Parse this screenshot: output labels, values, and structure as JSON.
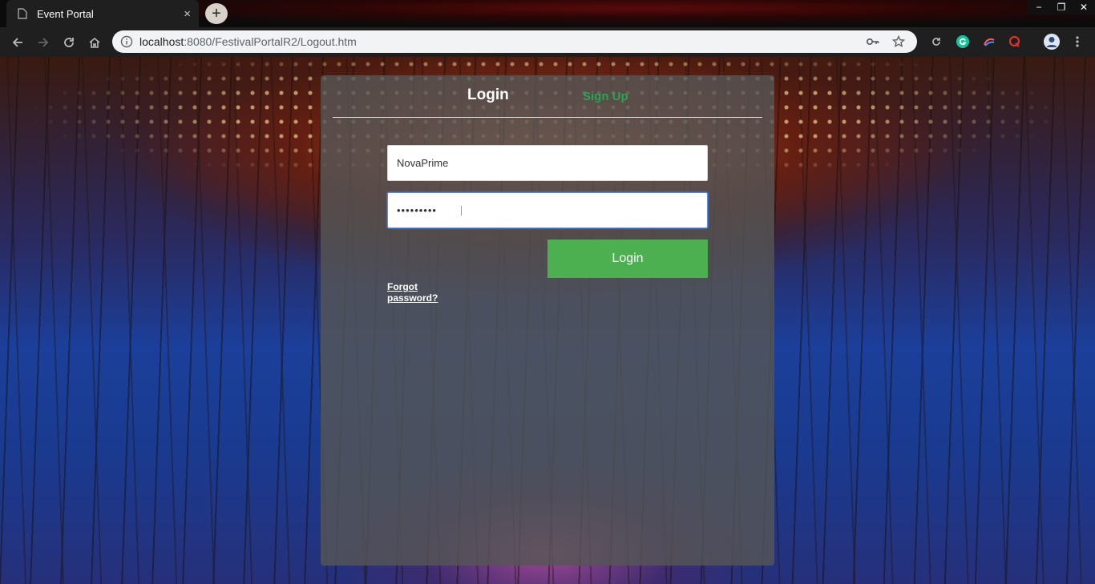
{
  "browser": {
    "tab_title": "Event Portal",
    "tab_close": "×",
    "new_tab": "+",
    "url_host": "localhost",
    "url_path": ":8080/FestivalPortalR2/Logout.htm",
    "window_controls": [
      "−",
      "❐",
      "✕"
    ]
  },
  "page": {
    "tabs": {
      "login": "Login",
      "signup": "Sign Up"
    },
    "username": {
      "value": "NovaPrime"
    },
    "password": {
      "value": "•••••••••"
    },
    "login_button": "Login",
    "forgot_password": "Forgot password?"
  },
  "colors": {
    "accent_green": "#4caf50",
    "signup_green": "#27a652",
    "card_bg": "rgba(85,85,85,.82)"
  }
}
